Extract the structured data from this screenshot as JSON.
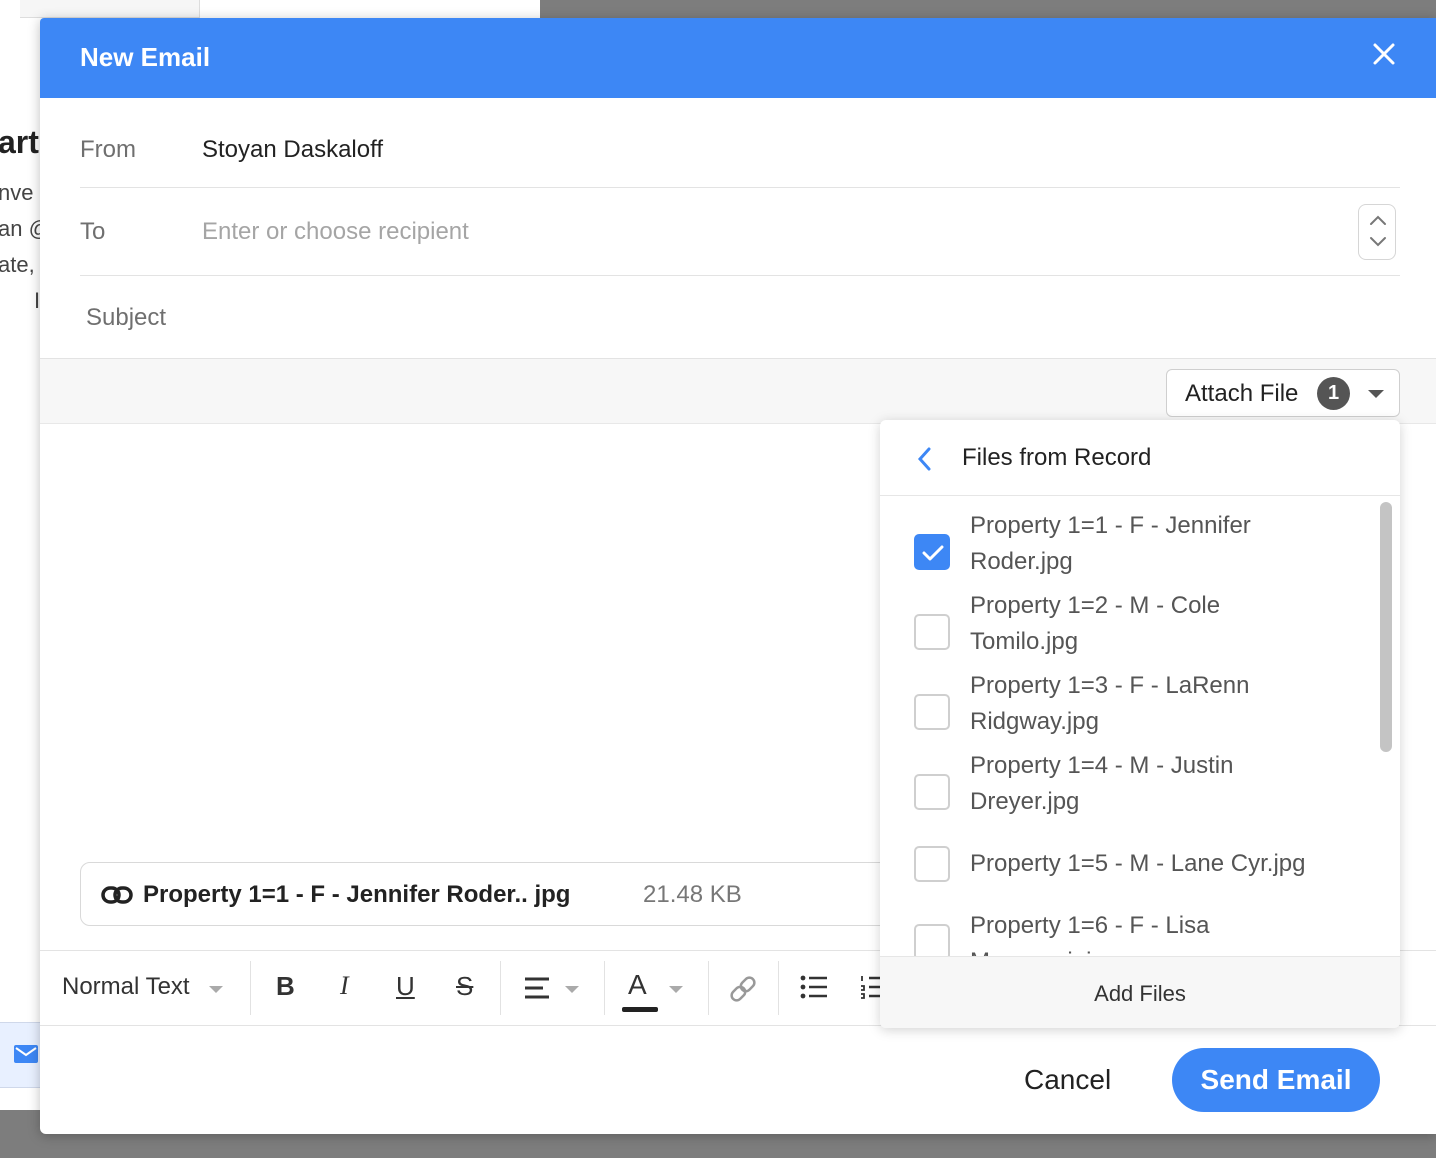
{
  "background": {
    "title_fragment": "art",
    "lines": [
      "nve",
      "an @",
      "ate,",
      "I"
    ]
  },
  "window": {
    "title": "New Email"
  },
  "form": {
    "from_label": "From",
    "from_value": "Stoyan Daskaloff",
    "to_label": "To",
    "to_placeholder": "Enter or choose recipient",
    "subject_label": "Subject"
  },
  "attach": {
    "label": "Attach File",
    "count": "1"
  },
  "attachment": {
    "name": "Property 1=1 - F - Jennifer Roder.. jpg",
    "size": "21.48 KB"
  },
  "toolbar": {
    "style_label": "Normal Text",
    "bold": "B",
    "italic": "I",
    "underline": "U",
    "strike": "S",
    "font_color": "A"
  },
  "footer": {
    "cancel": "Cancel",
    "send": "Send Email"
  },
  "dropdown": {
    "title": "Files from Record",
    "add_files": "Add Files",
    "files": [
      {
        "line1": "Property 1=1 - F - Jennifer",
        "line2": "Roder.jpg",
        "checked": true
      },
      {
        "line1": "Property 1=2 - M - Cole",
        "line2": "Tomilo.jpg",
        "checked": false
      },
      {
        "line1": "Property 1=3 - F - LaRenn",
        "line2": "Ridgway.jpg",
        "checked": false
      },
      {
        "line1": "Property 1=4 - M - Justin",
        "line2": "Dreyer.jpg",
        "checked": false
      },
      {
        "line1": "Property 1=5 - M - Lane Cyr.jpg",
        "line2": "",
        "checked": false
      },
      {
        "line1": "Property 1=6 - F - Lisa",
        "line2": "Manzzanini",
        "checked": false
      }
    ]
  },
  "colors": {
    "accent": "#3d87f5",
    "header_text": "#ffffff"
  }
}
